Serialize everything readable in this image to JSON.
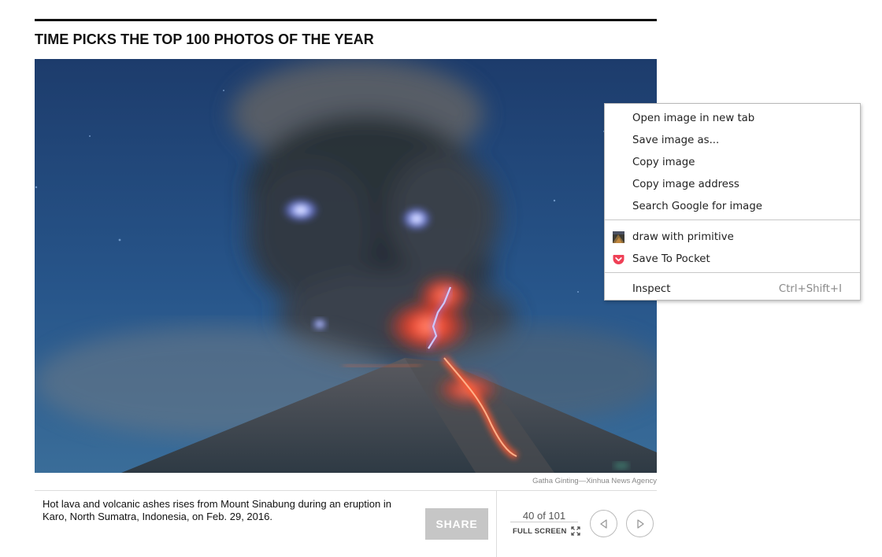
{
  "gallery": {
    "title": "TIME PICKS THE TOP 100 PHOTOS OF THE YEAR",
    "photo_alt": "Volcano eruption at night with lava and lightning",
    "credit": "Gatha Ginting—Xinhua News Agency",
    "caption": "Hot lava and volcanic ashes rises from Mount Sinabung during an eruption in Karo, North Sumatra, Indonesia, on Feb. 29, 2016.",
    "share_label": "SHARE",
    "counter": "40 of 101",
    "fullscreen_label": "FULL SCREEN"
  },
  "context_menu": {
    "items": [
      {
        "label": "Open image in new tab"
      },
      {
        "label": "Save image as..."
      },
      {
        "label": "Copy image"
      },
      {
        "label": "Copy image address"
      },
      {
        "label": "Search Google for image"
      },
      {
        "label": "draw with primitive",
        "icon": "primitive-extension-icon"
      },
      {
        "label": "Save To Pocket",
        "icon": "pocket-icon"
      },
      {
        "label": "Inspect",
        "shortcut": "Ctrl+Shift+I"
      }
    ]
  },
  "colors": {
    "share_bg": "#c6c6c6",
    "pocket_red": "#ef4056",
    "menu_border": "#b9b9b9"
  }
}
